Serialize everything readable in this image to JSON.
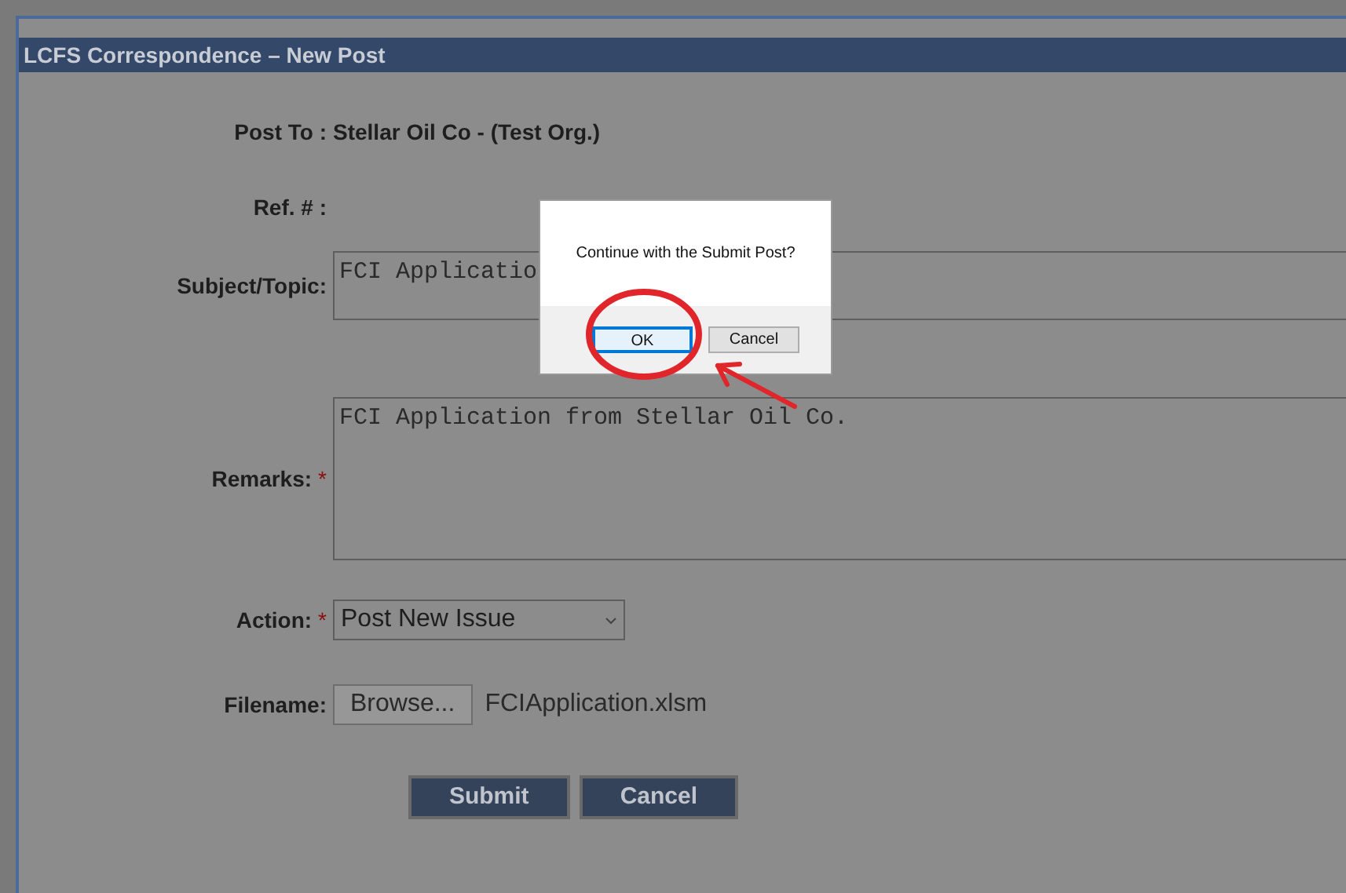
{
  "window": {
    "title": "LCFS Correspondence – New Post"
  },
  "form": {
    "post_to": {
      "label": "Post To :",
      "value": "Stellar Oil Co - (Test Org.)"
    },
    "ref": {
      "label": "Ref. # :"
    },
    "subject": {
      "label": "Subject/Topic:",
      "value": "FCI Applicatio"
    },
    "remarks": {
      "label": "Remarks:",
      "required_mark": "*",
      "value": "FCI Application from Stellar Oil Co."
    },
    "action": {
      "label": "Action:",
      "required_mark": "*",
      "value": "Post New Issue"
    },
    "filename": {
      "label": "Filename:",
      "button": "Browse...",
      "value": "FCIApplication.xlsm"
    },
    "buttons": [
      "Submit",
      "Cancel"
    ]
  },
  "dialog": {
    "message": "Continue with the Submit Post?",
    "buttons": [
      {
        "label": "OK",
        "selected": true
      },
      {
        "label": "Cancel",
        "selected": false
      }
    ]
  }
}
